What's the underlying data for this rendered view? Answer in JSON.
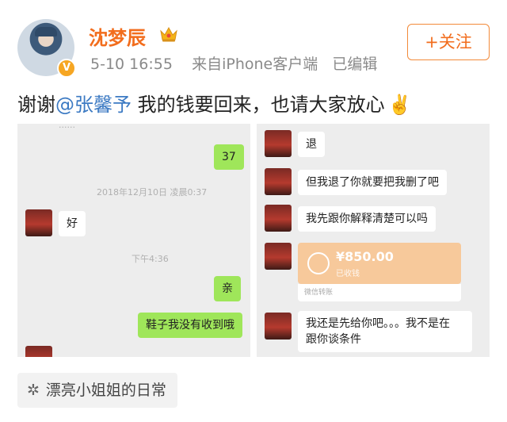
{
  "user": {
    "name": "沈梦辰",
    "verified_badge": "V",
    "crown_icon": "crown-icon",
    "time": "5-10 16:55",
    "source": "来自iPhone客户端",
    "edited": "已编辑"
  },
  "follow_label": "+关注",
  "post": {
    "prefix": "谢谢",
    "mention": "@张馨予",
    "suffix": " 我的钱要回来，也请大家放心",
    "emoji": "✌️"
  },
  "left_image": {
    "bubble_37": "37",
    "stamp_1": "2018年12月10日 凌晨0:37",
    "bubble_hao": "好",
    "stamp_2": "下午4:36",
    "bubble_qin": "亲",
    "bubble_shoes": "鞋子我没有收到哦"
  },
  "right_image": {
    "bubble_1": "退",
    "bubble_2": "但我退了你就要把我删了吧",
    "bubble_3": "我先跟你解释清楚可以吗",
    "transfer_amount": "¥850.00",
    "transfer_sub": "已收钱",
    "transfer_foot": "微信转账",
    "bubble_4_line1": "我还是先给你吧。。。我不是在",
    "bubble_4_line2": "跟你谈条件"
  },
  "tag": {
    "icon": "sparkle-icon",
    "label": "漂亮小姐姐的日常"
  },
  "colors": {
    "name": "#f26d1d",
    "mention": "#3c7ac3",
    "wechat_green": "#9fe65a",
    "transfer": "#f7c99b"
  }
}
